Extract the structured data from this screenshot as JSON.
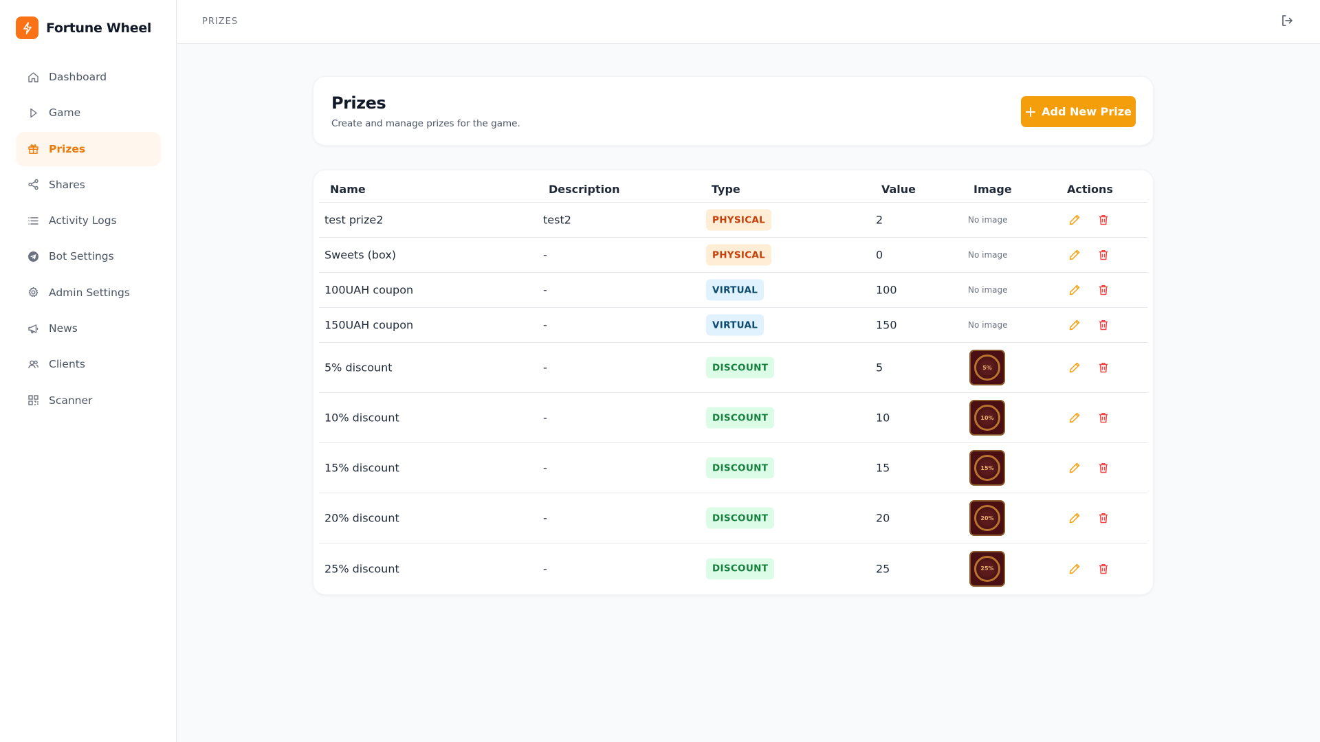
{
  "brand": {
    "name": "Fortune Wheel"
  },
  "colors": {
    "accent": "#f59e0b",
    "active_nav_bg": "#fff7ed",
    "active_nav_text": "#ea7a0a",
    "delete": "#ef4444"
  },
  "sidebar": {
    "items": [
      {
        "label": "Dashboard",
        "icon": "home-icon",
        "active": false
      },
      {
        "label": "Game",
        "icon": "play-icon",
        "active": false
      },
      {
        "label": "Prizes",
        "icon": "gift-icon",
        "active": true
      },
      {
        "label": "Shares",
        "icon": "share-icon",
        "active": false
      },
      {
        "label": "Activity Logs",
        "icon": "list-icon",
        "active": false
      },
      {
        "label": "Bot Settings",
        "icon": "telegram-icon",
        "active": false
      },
      {
        "label": "Admin Settings",
        "icon": "gear-icon",
        "active": false
      },
      {
        "label": "News",
        "icon": "megaphone-icon",
        "active": false
      },
      {
        "label": "Clients",
        "icon": "users-icon",
        "active": false
      },
      {
        "label": "Scanner",
        "icon": "qr-code-icon",
        "active": false
      }
    ]
  },
  "header": {
    "breadcrumb": "PRIZES"
  },
  "page": {
    "title": "Prizes",
    "subtitle": "Create and manage prizes for the game.",
    "add_button": "Add New Prize"
  },
  "table": {
    "columns": [
      "Name",
      "Description",
      "Type",
      "Value",
      "Image",
      "Actions"
    ],
    "no_image_text": "No image",
    "rows": [
      {
        "name": "test prize2",
        "description": "test2",
        "type": "PHYSICAL",
        "value": "2",
        "image": null
      },
      {
        "name": "Sweets (box)",
        "description": "-",
        "type": "PHYSICAL",
        "value": "0",
        "image": null
      },
      {
        "name": "100UAH coupon",
        "description": "-",
        "type": "VIRTUAL",
        "value": "100",
        "image": null
      },
      {
        "name": "150UAH coupon",
        "description": "-",
        "type": "VIRTUAL",
        "value": "150",
        "image": null
      },
      {
        "name": "5% discount",
        "description": "-",
        "type": "DISCOUNT",
        "value": "5",
        "image": "5%"
      },
      {
        "name": "10% discount",
        "description": "-",
        "type": "DISCOUNT",
        "value": "10",
        "image": "10%"
      },
      {
        "name": "15% discount",
        "description": "-",
        "type": "DISCOUNT",
        "value": "15",
        "image": "15%"
      },
      {
        "name": "20% discount",
        "description": "-",
        "type": "DISCOUNT",
        "value": "20",
        "image": "20%"
      },
      {
        "name": "25% discount",
        "description": "-",
        "type": "DISCOUNT",
        "value": "25",
        "image": "25%"
      }
    ]
  }
}
